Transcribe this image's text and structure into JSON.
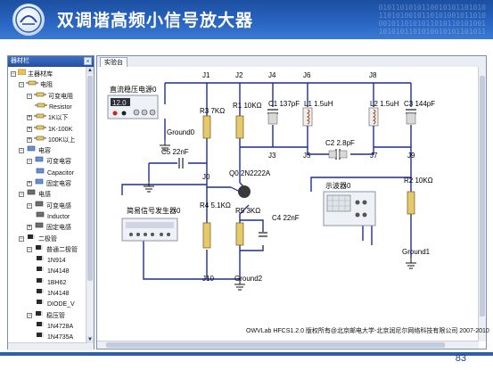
{
  "slide": {
    "title": "双调谐高频小信号放大器",
    "page_number": "83",
    "colors": {
      "header": "#2a66c4",
      "wire": "#1c2f8c",
      "accent": "#1e3f86"
    }
  },
  "left_panel": {
    "title": "器材栏",
    "close_icon": "close-icon",
    "tree": [
      {
        "label": "主器材库",
        "level": 0,
        "toggle": "−",
        "icon": "folder-icon"
      },
      {
        "label": "电阻",
        "level": 1,
        "toggle": "−",
        "icon": "resistor-icon"
      },
      {
        "label": "可变电阻",
        "level": 2,
        "toggle": "−",
        "icon": "resistor-icon"
      },
      {
        "label": "Resistor",
        "level": 3,
        "toggle": "",
        "icon": "resistor-icon"
      },
      {
        "label": "1K以下",
        "level": 2,
        "toggle": "+",
        "icon": "resistor-icon"
      },
      {
        "label": "1K-100K",
        "level": 2,
        "toggle": "+",
        "icon": "resistor-icon"
      },
      {
        "label": "100K以上",
        "level": 2,
        "toggle": "+",
        "icon": "resistor-icon"
      },
      {
        "label": "电容",
        "level": 1,
        "toggle": "−",
        "icon": "capacitor-icon"
      },
      {
        "label": "可变电容",
        "level": 2,
        "toggle": "−",
        "icon": "capacitor-icon"
      },
      {
        "label": "Capacitor",
        "level": 3,
        "toggle": "",
        "icon": "capacitor-icon"
      },
      {
        "label": "固定电容",
        "level": 2,
        "toggle": "+",
        "icon": "capacitor-icon"
      },
      {
        "label": "电感",
        "level": 1,
        "toggle": "−",
        "icon": "inductor-icon"
      },
      {
        "label": "可变电感",
        "level": 2,
        "toggle": "−",
        "icon": "inductor-icon"
      },
      {
        "label": "Inductor",
        "level": 3,
        "toggle": "",
        "icon": "inductor-icon"
      },
      {
        "label": "固定电感",
        "level": 2,
        "toggle": "+",
        "icon": "inductor-icon"
      },
      {
        "label": "二极管",
        "level": 1,
        "toggle": "−",
        "icon": "diode-icon"
      },
      {
        "label": "普通二极管",
        "level": 2,
        "toggle": "−",
        "icon": "diode-icon"
      },
      {
        "label": "1N914",
        "level": 3,
        "toggle": "",
        "icon": "diode-icon"
      },
      {
        "label": "1N4148",
        "level": 3,
        "toggle": "",
        "icon": "diode-icon"
      },
      {
        "label": "1BH62",
        "level": 3,
        "toggle": "",
        "icon": "diode-icon"
      },
      {
        "label": "1N4148",
        "level": 3,
        "toggle": "",
        "icon": "diode-icon"
      },
      {
        "label": "DIODE_V",
        "level": 3,
        "toggle": "",
        "icon": "diode-icon"
      },
      {
        "label": "稳压管",
        "level": 2,
        "toggle": "−",
        "icon": "diode-icon"
      },
      {
        "label": "1N4728A",
        "level": 3,
        "toggle": "",
        "icon": "diode-icon"
      },
      {
        "label": "1N4735A",
        "level": 3,
        "toggle": "",
        "icon": "diode-icon"
      }
    ]
  },
  "workspace": {
    "tab_label": "实验台",
    "footer": "OWVLab HFCS1.2.0 版权所有@北京邮电大学-北京润尼尔网络科技有限公司 2007-2010",
    "dc_source": {
      "label": "直流稳压电源0",
      "display": "12.0"
    },
    "signal_generator": {
      "label": "简易信号发生器0"
    },
    "oscilloscope": {
      "label": "示波器0"
    },
    "grounds": [
      "Ground0",
      "Ground1",
      "Ground2"
    ],
    "junctions": [
      "J1",
      "J2",
      "J4",
      "J6",
      "J8",
      "J0",
      "J3",
      "J5",
      "J7",
      "J9",
      "J10"
    ],
    "components": {
      "R3": "R3 7KΩ",
      "R1": "R1 10KΩ",
      "C1": "C1 137pF",
      "L1": "L1 1.5uH",
      "C2": "C2 2.8pF",
      "L2": "L2 1.5uH",
      "C3": "C3 144pF",
      "C5": "C5 22nF",
      "Q0": "Q0 2N2222A",
      "R4": "R4 5.1KΩ",
      "R5": "R5 3KΩ",
      "C4": "C4 22nF",
      "R2": "R2 10KΩ"
    }
  }
}
